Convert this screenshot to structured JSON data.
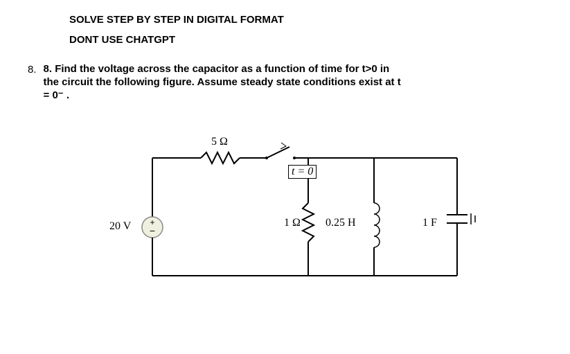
{
  "header": {
    "line1": "SOLVE STEP BY STEP IN DIGITAL FORMAT",
    "line2": "DONT USE CHATGPT"
  },
  "question": {
    "number": "8.",
    "text": "8. Find the voltage across the capacitor as a function of time for t>0 in the circuit the following figure. Assume steady state conditions exist at t = 0⁻ ."
  },
  "circuit": {
    "source_label": "20 V",
    "resistor1_label": "5 Ω",
    "switch_label": "t = 0",
    "resistor2_label": "1 Ω",
    "inductor_label": "0.25 H",
    "capacitor_label": "1 F"
  }
}
